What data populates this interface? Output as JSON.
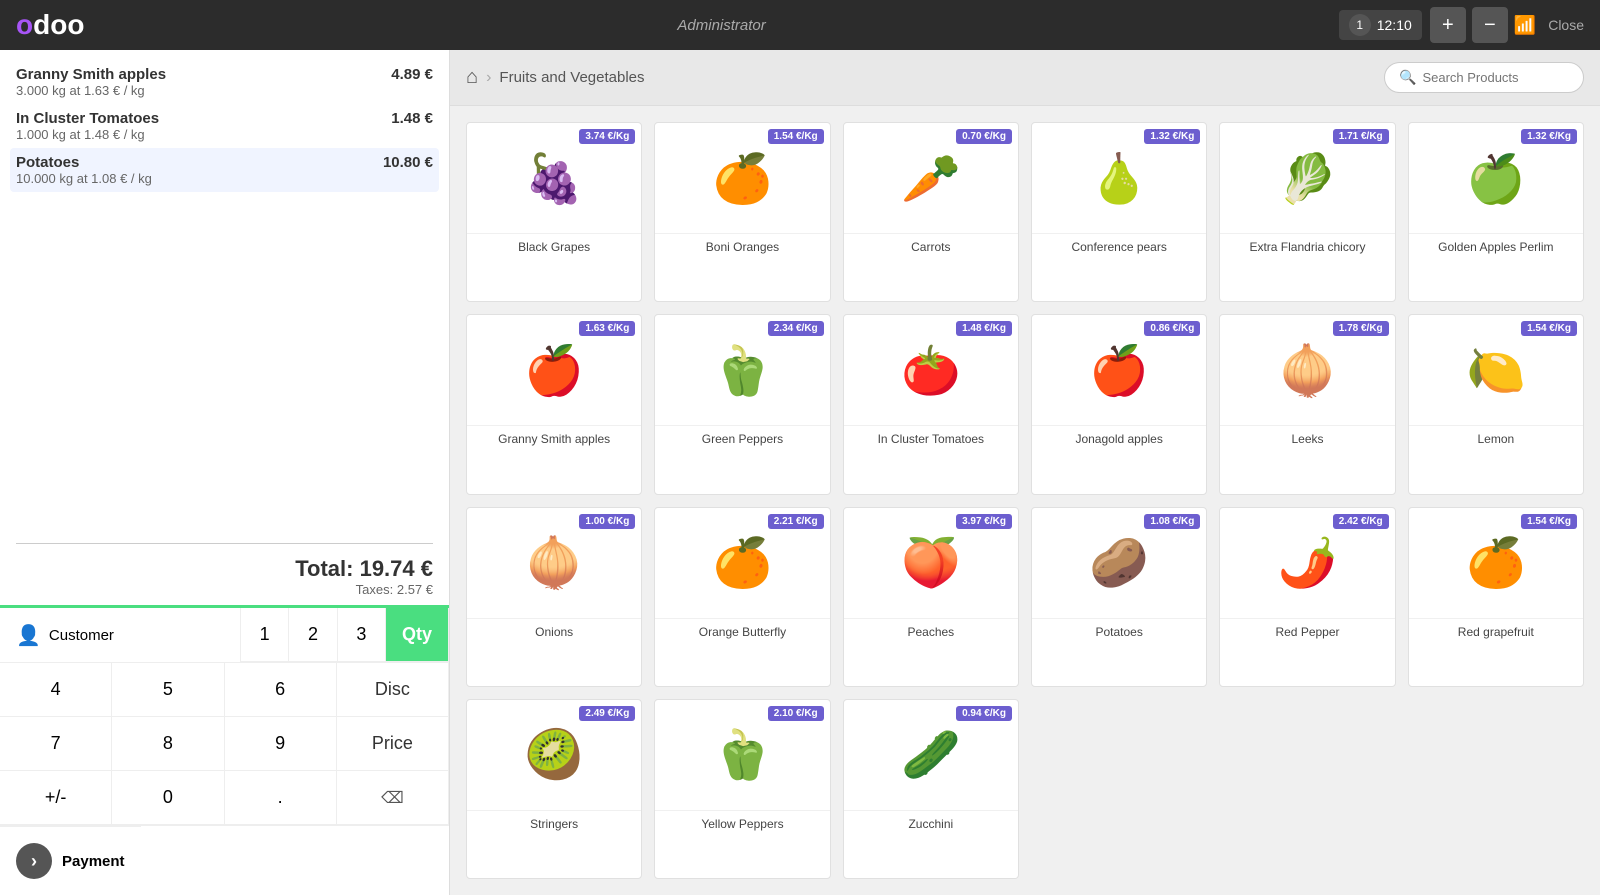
{
  "topbar": {
    "logo_text": "odoo",
    "admin_label": "Administrator",
    "order_tab_num": "1",
    "order_tab_time": "12:10",
    "add_btn": "+",
    "remove_btn": "−",
    "close_label": "Close"
  },
  "order": {
    "items": [
      {
        "name": "Granny Smith apples",
        "price": "4.89 €",
        "detail": "3.000 kg at 1.63 € / kg"
      },
      {
        "name": "In Cluster Tomatoes",
        "price": "1.48 €",
        "detail": "1.000 kg at 1.48 € / kg"
      },
      {
        "name": "Potatoes",
        "price": "10.80 €",
        "detail": "10.000 kg at 1.08 € / kg",
        "selected": true
      }
    ],
    "total_label": "Total: 19.74 €",
    "taxes_label": "Taxes: 2.57 €"
  },
  "numpad": {
    "customer_label": "Customer",
    "keys": [
      "1",
      "2",
      "3",
      "4",
      "5",
      "6",
      "7",
      "8",
      "9",
      "+/-",
      "0",
      "."
    ],
    "qty_label": "Qty",
    "disc_label": "Disc",
    "price_label": "Price",
    "payment_label": "Payment"
  },
  "breadcrumb": {
    "home_icon": "⌂",
    "category": "Fruits and Vegetables",
    "search_placeholder": "Search Products"
  },
  "products": [
    {
      "name": "Black Grapes",
      "price": "3.74 €/Kg",
      "emoji": "🍇"
    },
    {
      "name": "Boni Oranges",
      "price": "1.54 €/Kg",
      "emoji": "🍊"
    },
    {
      "name": "Carrots",
      "price": "0.70 €/Kg",
      "emoji": "🥕"
    },
    {
      "name": "Conference pears",
      "price": "1.32 €/Kg",
      "emoji": "🍐"
    },
    {
      "name": "Extra Flandria chicory",
      "price": "1.71 €/Kg",
      "emoji": "🥬"
    },
    {
      "name": "Golden Apples Perlim",
      "price": "1.32 €/Kg",
      "emoji": "🍏"
    },
    {
      "name": "Granny Smith apples",
      "price": "1.63 €/Kg",
      "emoji": "🍎"
    },
    {
      "name": "Green Peppers",
      "price": "2.34 €/Kg",
      "emoji": "🫑"
    },
    {
      "name": "In Cluster Tomatoes",
      "price": "1.48 €/Kg",
      "emoji": "🍅"
    },
    {
      "name": "Jonagold apples",
      "price": "0.86 €/Kg",
      "emoji": "🍎"
    },
    {
      "name": "Leeks",
      "price": "1.78 €/Kg",
      "emoji": "🧅"
    },
    {
      "name": "Lemon",
      "price": "1.54 €/Kg",
      "emoji": "🍋"
    },
    {
      "name": "Onions",
      "price": "1.00 €/Kg",
      "emoji": "🧅"
    },
    {
      "name": "Orange Butterfly",
      "price": "2.21 €/Kg",
      "emoji": "🍊"
    },
    {
      "name": "Peaches",
      "price": "3.97 €/Kg",
      "emoji": "🍑"
    },
    {
      "name": "Potatoes",
      "price": "1.08 €/Kg",
      "emoji": "🥔"
    },
    {
      "name": "Red Pepper",
      "price": "2.42 €/Kg",
      "emoji": "🌶️"
    },
    {
      "name": "Red grapefruit",
      "price": "1.54 €/Kg",
      "emoji": "🍊"
    },
    {
      "name": "Stringers",
      "price": "2.49 €/Kg",
      "emoji": "🥝"
    },
    {
      "name": "Yellow Peppers",
      "price": "2.10 €/Kg",
      "emoji": "🫑"
    },
    {
      "name": "Zucchini",
      "price": "0.94 €/Kg",
      "emoji": "🥒"
    }
  ]
}
